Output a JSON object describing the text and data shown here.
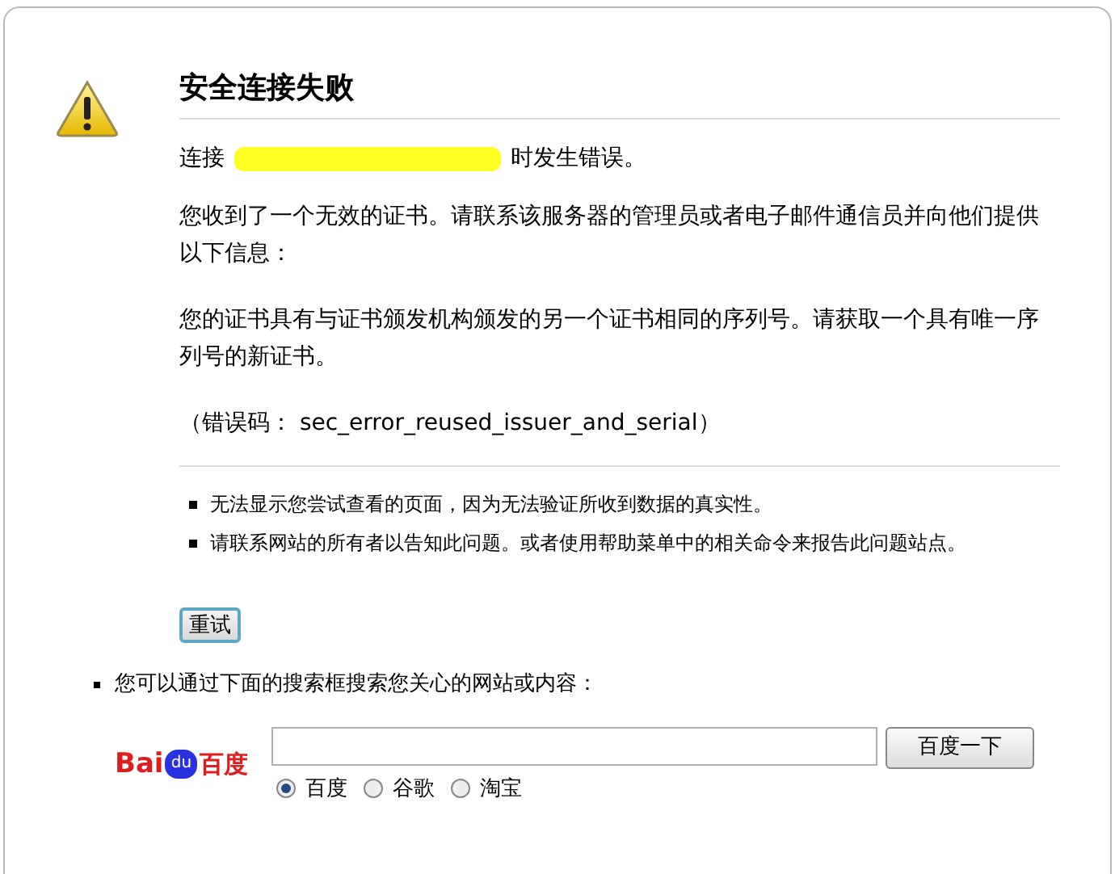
{
  "title": "安全连接失败",
  "connect_message": {
    "before": "连接",
    "after": "时发生错误。",
    "redacted": true
  },
  "paragraphs": [
    "您收到了一个无效的证书。请联系该服务器的管理员或者电子邮件通信员并向他们提供以下信息：",
    "您的证书具有与证书颁发机构颁发的另一个证书相同的序列号。请获取一个具有唯一序列号的新证书。",
    "（错误码： sec_error_reused_issuer_and_serial）"
  ],
  "bullets": [
    "无法显示您尝试查看的页面，因为无法验证所收到数据的真实性。",
    "请联系网站的所有者以告知此问题。或者使用帮助菜单中的相关命令来报告此问题站点。"
  ],
  "retry_button": "重试",
  "search_hint": "您可以通过下面的搜索框搜索您关心的网站或内容：",
  "logo": {
    "left": "Bai",
    "paw": "du",
    "right": "百度"
  },
  "search_button": "百度一下",
  "engines": [
    {
      "label": "百度",
      "selected": true
    },
    {
      "label": "谷歌",
      "selected": false
    },
    {
      "label": "淘宝",
      "selected": false
    }
  ]
}
